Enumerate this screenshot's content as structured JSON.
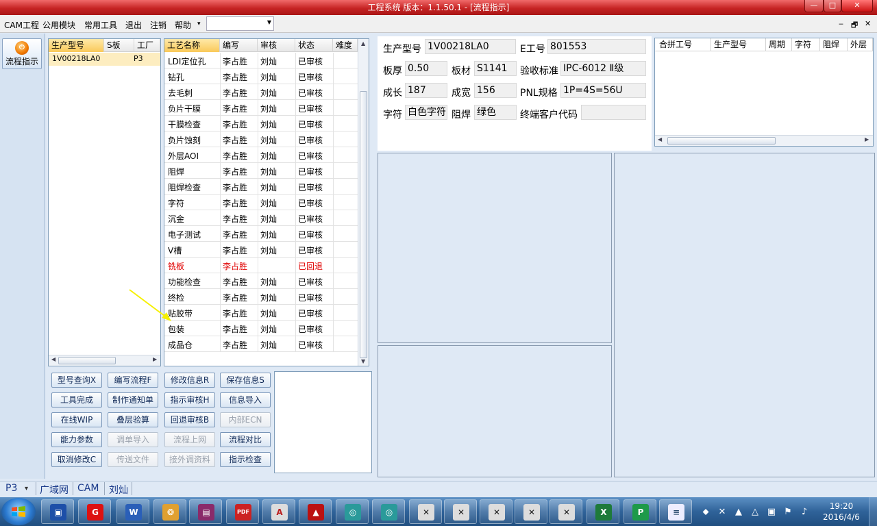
{
  "window": {
    "title": "工程系统   版本：1.1.50.1 - [流程指示]",
    "min": "—",
    "max": "□",
    "close": "✕"
  },
  "menu": {
    "items": [
      "CAM工程",
      "公用模块",
      "常用工具",
      "退出",
      "注销",
      "帮助",
      "▾"
    ],
    "combo_value": "",
    "mdi": [
      "‒",
      "🗗",
      "✕"
    ]
  },
  "toolbar": {
    "flow_button": "流程指示"
  },
  "model_grid": {
    "headers": [
      "生产型号",
      "S板",
      "工厂"
    ],
    "row": [
      "1V00218LA0",
      "",
      "P3"
    ]
  },
  "process_grid": {
    "headers": [
      "工艺名称",
      "编写",
      "审核",
      "状态",
      "难度"
    ],
    "rows": [
      [
        "LDI定位孔",
        "李占胜",
        "刘灿",
        "已审核"
      ],
      [
        "钻孔",
        "李占胜",
        "刘灿",
        "已审核"
      ],
      [
        "去毛刺",
        "李占胜",
        "刘灿",
        "已审核"
      ],
      [
        "负片干膜",
        "李占胜",
        "刘灿",
        "已审核"
      ],
      [
        "干膜检查",
        "李占胜",
        "刘灿",
        "已审核"
      ],
      [
        "负片蚀刻",
        "李占胜",
        "刘灿",
        "已审核"
      ],
      [
        "外层AOI",
        "李占胜",
        "刘灿",
        "已审核"
      ],
      [
        "阻焊",
        "李占胜",
        "刘灿",
        "已审核"
      ],
      [
        "阻焊检查",
        "李占胜",
        "刘灿",
        "已审核"
      ],
      [
        "字符",
        "李占胜",
        "刘灿",
        "已审核"
      ],
      [
        "沉金",
        "李占胜",
        "刘灿",
        "已审核"
      ],
      [
        "电子测试",
        "李占胜",
        "刘灿",
        "已审核"
      ],
      [
        "V槽",
        "李占胜",
        "刘灿",
        "已审核"
      ],
      [
        "铣板",
        "李占胜",
        "",
        "已回退"
      ],
      [
        "功能检查",
        "李占胜",
        "刘灿",
        "已审核"
      ],
      [
        "终检",
        "李占胜",
        "刘灿",
        "已审核"
      ],
      [
        "贴胶带",
        "李占胜",
        "刘灿",
        "已审核"
      ],
      [
        "包装",
        "李占胜",
        "刘灿",
        "已审核"
      ],
      [
        "成品仓",
        "李占胜",
        "刘灿",
        "已审核"
      ]
    ],
    "returned_row_index": 13
  },
  "buttons": [
    {
      "label": "型号查询X",
      "enabled": true
    },
    {
      "label": "编写流程F",
      "enabled": true
    },
    {
      "label": "修改信息R",
      "enabled": true
    },
    {
      "label": "保存信息S",
      "enabled": true
    },
    {
      "label": "工具完成",
      "enabled": true
    },
    {
      "label": "制作通知单",
      "enabled": true
    },
    {
      "label": "指示审核H",
      "enabled": true
    },
    {
      "label": "信息导入",
      "enabled": true
    },
    {
      "label": "在线WIP",
      "enabled": true
    },
    {
      "label": "叠层验算",
      "enabled": true
    },
    {
      "label": "回退审核B",
      "enabled": true
    },
    {
      "label": "内部ECN",
      "enabled": false
    },
    {
      "label": "能力参数",
      "enabled": true
    },
    {
      "label": "调单导入",
      "enabled": false
    },
    {
      "label": "流程上网",
      "enabled": false
    },
    {
      "label": "流程对比",
      "enabled": true
    },
    {
      "label": "取消修改C",
      "enabled": true
    },
    {
      "label": "传送文件",
      "enabled": false
    },
    {
      "label": "接外调资料",
      "enabled": false
    },
    {
      "label": "指示检查",
      "enabled": true
    }
  ],
  "info": {
    "model_label": "生产型号",
    "model_value": "1V00218LA0",
    "e_label": "E工号",
    "e_value": "801553",
    "thick_label": "板厚",
    "thick_value": "0.50",
    "material_label": "板材",
    "material_value": "S1141",
    "std_label": "验收标准",
    "std_value": "IPC-6012 Ⅱ级",
    "length_label": "成长",
    "length_value": "187",
    "width_label": "成宽",
    "width_value": "156",
    "pnl_label": "PNL规格",
    "pnl_value": "1P=4S=56U",
    "char_label": "字符",
    "char_value": "白色字符",
    "mask_label": "阻焊",
    "mask_value": "绿色",
    "cust_label": "终端客户代码",
    "cust_value": ""
  },
  "merge_grid": {
    "headers": [
      "合拼工号",
      "生产型号",
      "周期",
      "字符",
      "阻焊",
      "外层"
    ]
  },
  "statusbar": {
    "factory": "P3",
    "network": "广域网",
    "module": "CAM",
    "user": "刘灿",
    "arrow": "▾"
  },
  "taskbar": {
    "apps": [
      "save-app",
      "redbrand-app",
      "word-app",
      "shell-app",
      "winrar-app",
      "pdf-app",
      "reader-app",
      "autocad-app",
      "wheel-app-1",
      "wheel-app-2",
      "x-app-1",
      "x-app-2",
      "x-app-3",
      "x-app-4",
      "x-app-5",
      "excel-app",
      "p-app",
      "notepad-app"
    ],
    "time": "19:20",
    "date": "2016/4/6"
  },
  "colors": {
    "accent": "#c62424",
    "selected_row": "#fdedc0",
    "returned_text": "#e00000",
    "link_blue": "#1a3a8a"
  }
}
